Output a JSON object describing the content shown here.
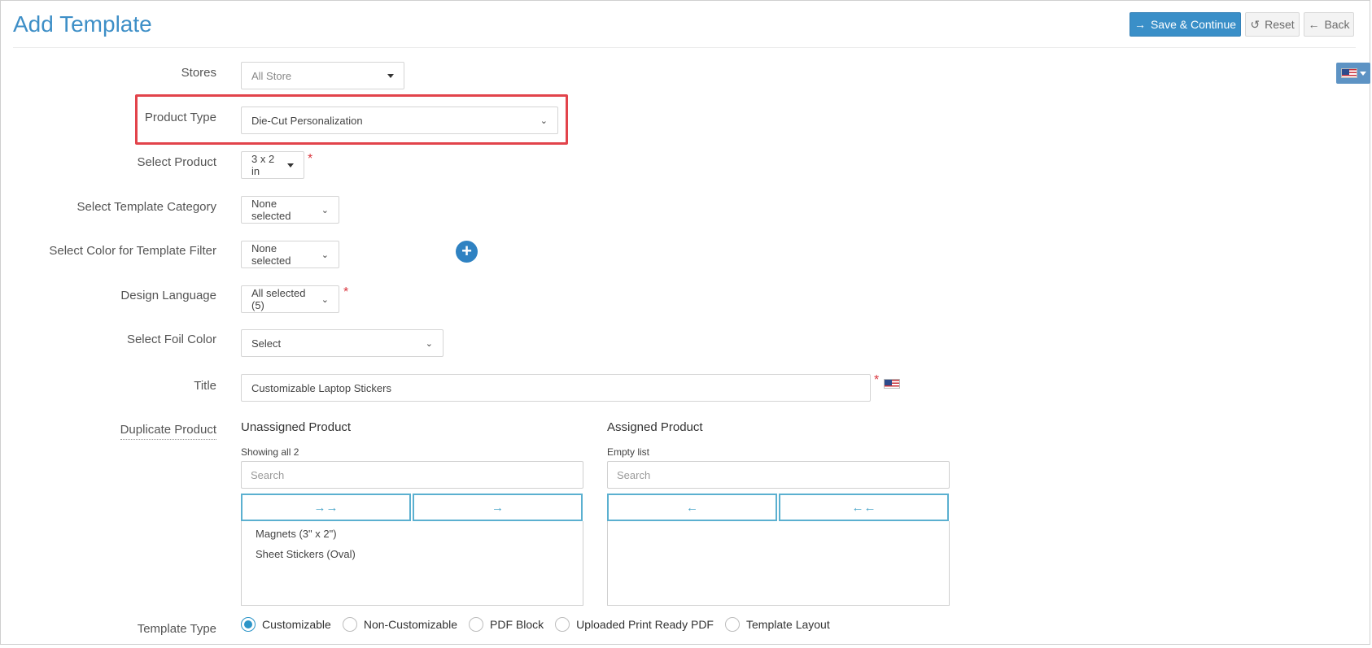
{
  "header": {
    "title": "Add Template",
    "save_label": "Save & Continue",
    "reset_label": "Reset",
    "back_label": "Back",
    "save_icon": "arrow-right-icon",
    "reset_icon": "undo-icon",
    "back_icon": "arrow-left-icon",
    "accent_color": "#3a8fc8"
  },
  "form": {
    "stores": {
      "label": "Stores",
      "value": "All Store"
    },
    "product_type": {
      "label": "Product Type",
      "value": "Die-Cut Personalization"
    },
    "select_product": {
      "label": "Select Product",
      "value": "3 x 2 in",
      "required": "*"
    },
    "template_category": {
      "label": "Select Template Category",
      "value": "None selected"
    },
    "color_filter": {
      "label": "Select Color for Template Filter",
      "value": "None selected"
    },
    "design_language": {
      "label": "Design Language",
      "value": "All selected (5)",
      "required": "*"
    },
    "foil_color": {
      "label": "Select Foil Color",
      "value": "Select"
    },
    "title": {
      "label": "Title",
      "value": "Customizable Laptop Stickers",
      "required": "*"
    },
    "duplicate_product": {
      "label": "Duplicate Product"
    },
    "template_type": {
      "label": "Template Type",
      "options": [
        "Customizable",
        "Non-Customizable",
        "PDF Block",
        "Uploaded Print Ready PDF",
        "Template Layout"
      ],
      "selected": "Customizable"
    }
  },
  "duallist": {
    "unassigned": {
      "heading": "Unassigned Product",
      "info": "Showing all 2",
      "search_placeholder": "Search",
      "btn_move_all": "→→",
      "btn_move": "→",
      "items": [
        "Magnets (3\" x 2\")",
        "Sheet Stickers (Oval)"
      ]
    },
    "assigned": {
      "heading": "Assigned Product",
      "info": "Empty list",
      "search_placeholder": "Search",
      "btn_remove": "←",
      "btn_remove_all": "←←",
      "items": []
    }
  },
  "language_flag": "us-flag-icon"
}
